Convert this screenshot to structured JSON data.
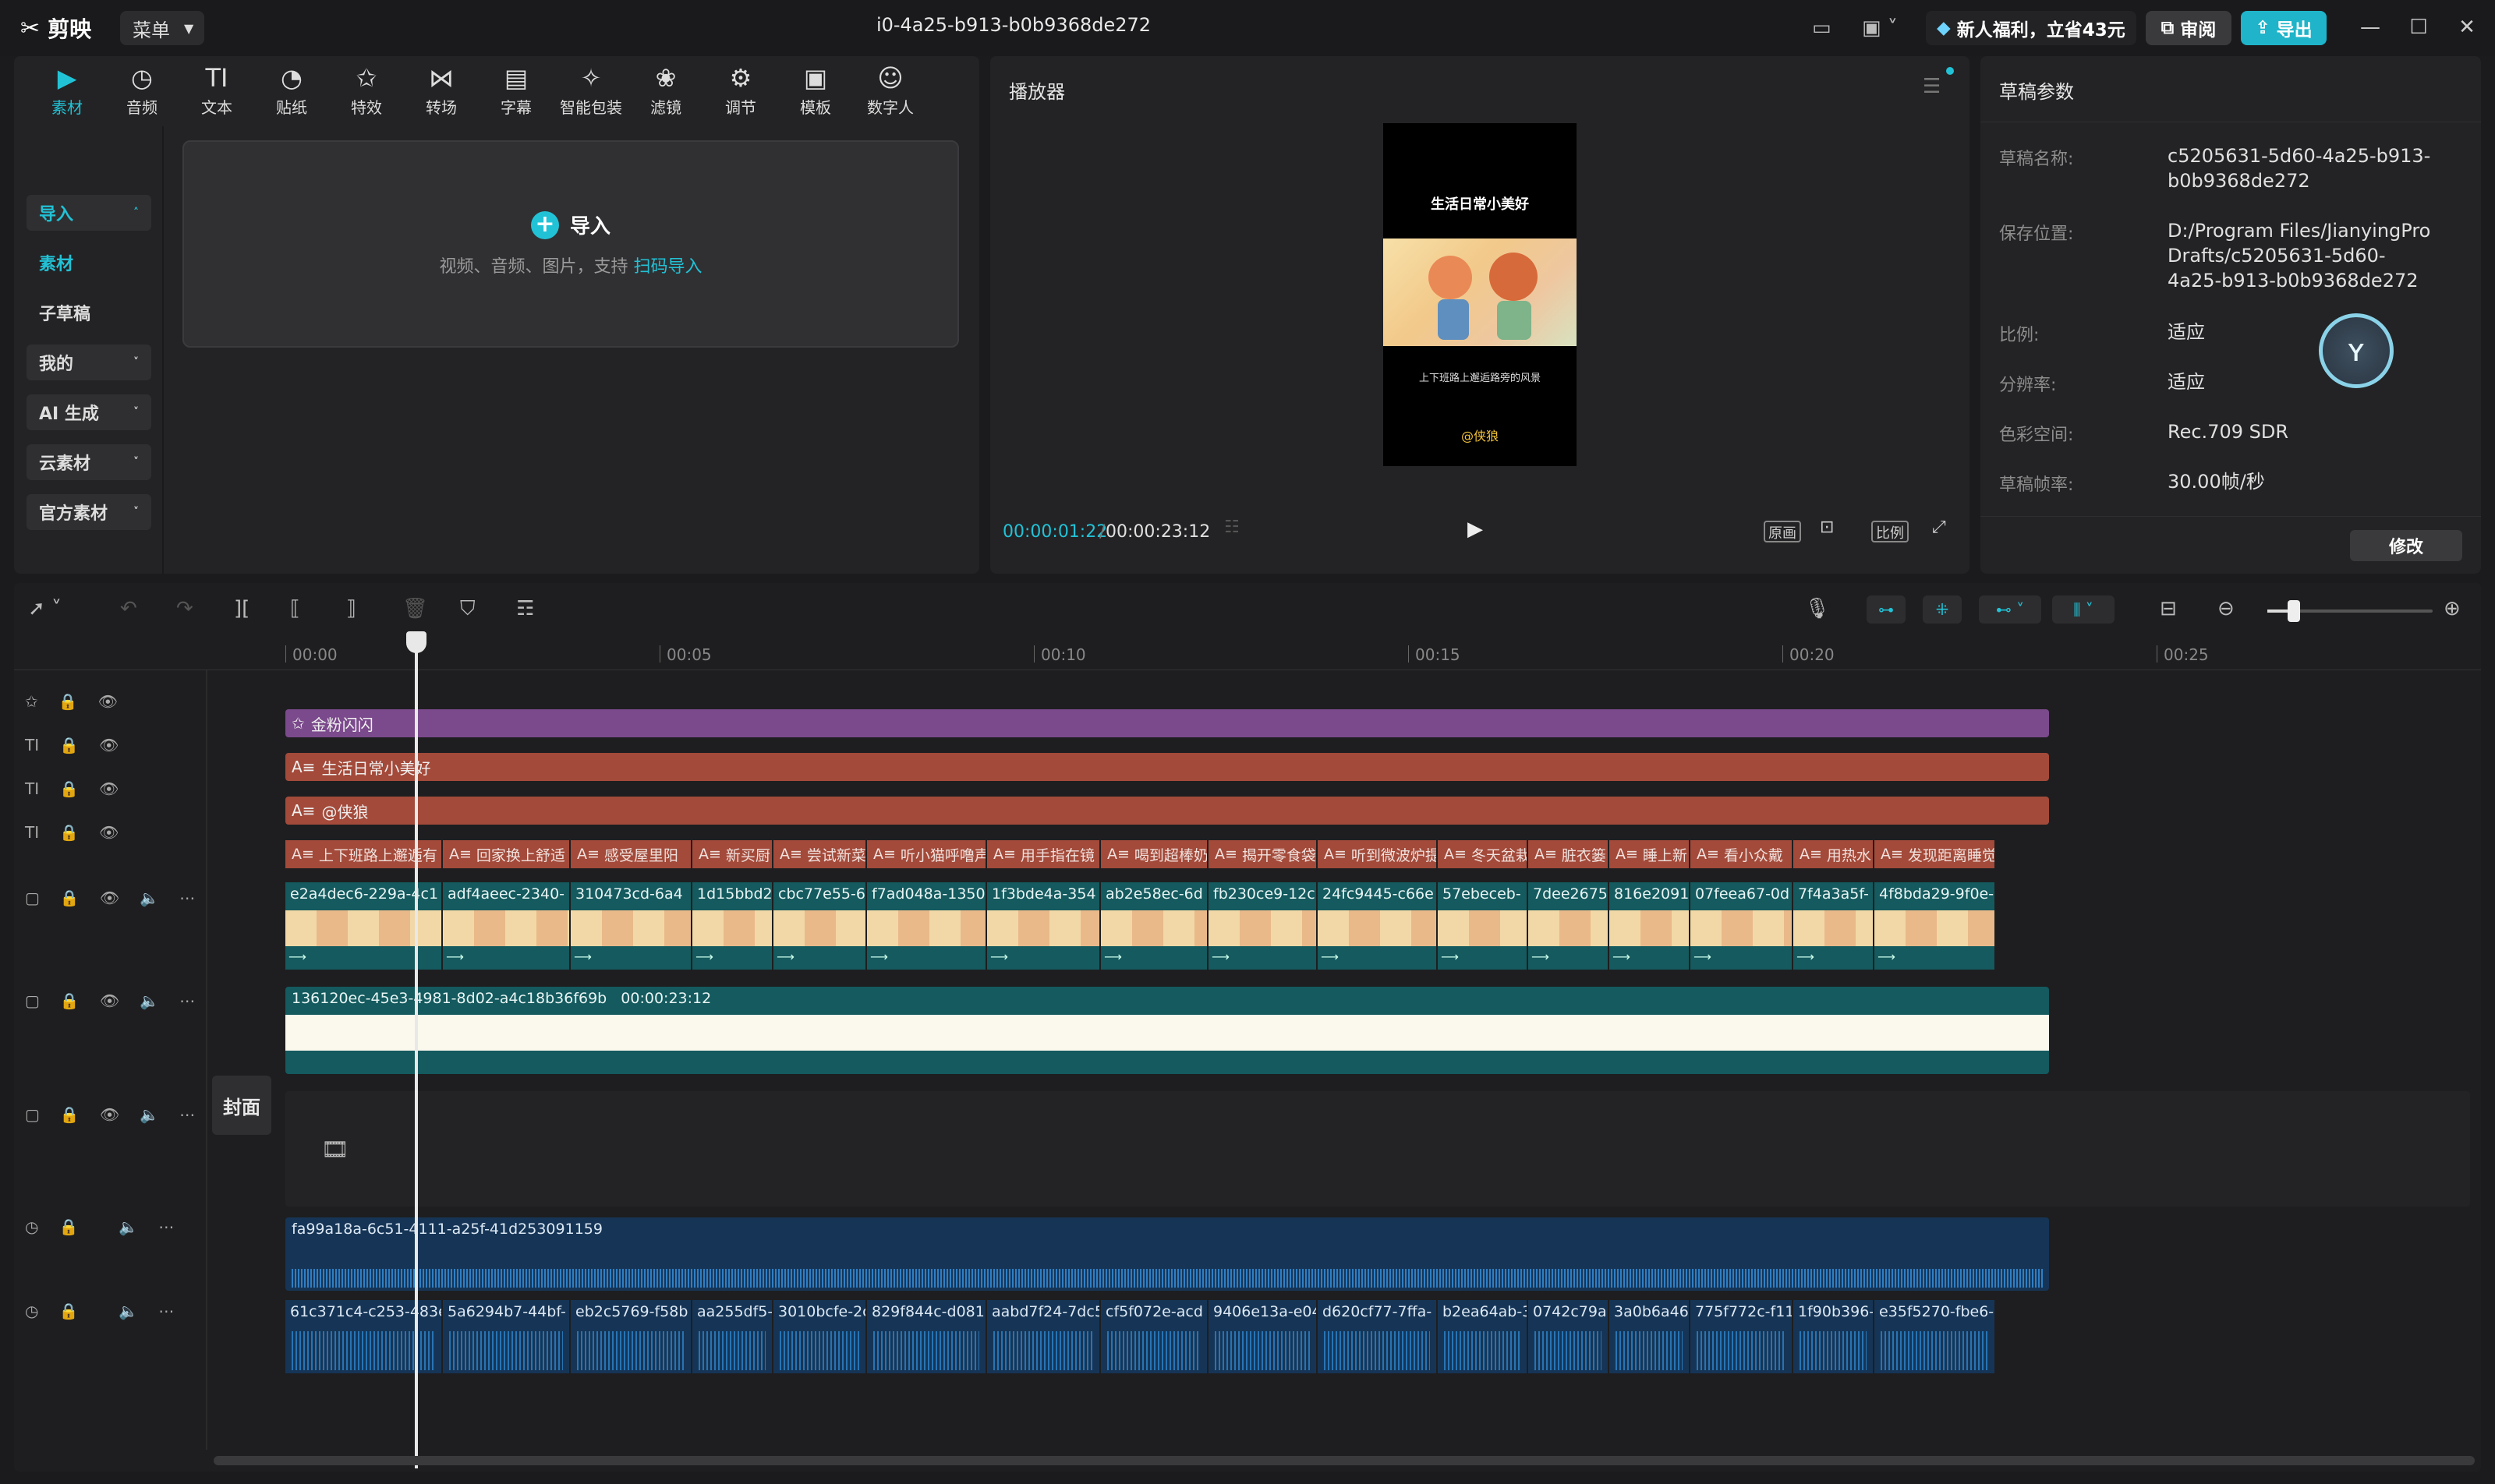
{
  "app": {
    "logo_text": "剪映",
    "menu_label": "菜单",
    "title": "i0-4a25-b913-b0b9368de272"
  },
  "header": {
    "promo": "新人福利，立省43元",
    "review": "审阅",
    "export": "导出"
  },
  "tools": [
    {
      "label": "素材",
      "icon": "▶",
      "active": true
    },
    {
      "label": "音频",
      "icon": "◷"
    },
    {
      "label": "文本",
      "icon": "TI"
    },
    {
      "label": "贴纸",
      "icon": "◔"
    },
    {
      "label": "特效",
      "icon": "✩"
    },
    {
      "label": "转场",
      "icon": "⋈"
    },
    {
      "label": "字幕",
      "icon": "▤"
    },
    {
      "label": "智能包装",
      "icon": "✧"
    },
    {
      "label": "滤镜",
      "icon": "❀"
    },
    {
      "label": "调节",
      "icon": "⚙"
    },
    {
      "label": "模板",
      "icon": "▣"
    },
    {
      "label": "数字人",
      "icon": "☺"
    }
  ],
  "nav": {
    "import": "导入",
    "material": "素材",
    "sub_draft": "子草稿",
    "mine": "我的",
    "ai": "AI 生成",
    "cloud": "云素材",
    "official": "官方素材"
  },
  "import_zone": {
    "title": "导入",
    "sub": "视频、音频、图片，支持",
    "link": "扫码导入"
  },
  "player": {
    "title": "播放器",
    "current": "00:00:01:22",
    "separator": "/",
    "total": "00:00:23:12",
    "original": "原画",
    "ratio": "比例",
    "preview_line1": "生活日常小美好",
    "preview_line2": "上下班路上邂逅路旁的风景",
    "preview_line3": "@侠狼"
  },
  "draft": {
    "title": "草稿参数",
    "rows": [
      {
        "label": "草稿名称:",
        "value": "c5205631-5d60-4a25-b913-b0b9368de272"
      },
      {
        "label": "保存位置:",
        "value": "D:/Program Files/JianyingPro Drafts/c5205631-5d60-4a25-b913-b0b9368de272"
      },
      {
        "label": "比例:",
        "value": "适应"
      },
      {
        "label": "分辨率:",
        "value": "适应"
      },
      {
        "label": "色彩空间:",
        "value": "Rec.709 SDR"
      },
      {
        "label": "草稿帧率:",
        "value": "30.00帧/秒"
      }
    ],
    "modify": "修改"
  },
  "ruler": [
    "00:00",
    "00:05",
    "00:10",
    "00:15",
    "00:20",
    "00:25"
  ],
  "tracks": {
    "effect": "金粉闪闪",
    "text1": "生活日常小美好",
    "text2": "@侠狼",
    "subtitles": [
      "上下班路上邂逅有",
      "回家换上舒适",
      "感受屋里阳",
      "新买厨",
      "尝试新菜",
      "听小猫呼噜声",
      "用手指在镜",
      "喝到超棒奶",
      "揭开零食袋",
      "听到微波炉提",
      "冬天盆栽",
      "脏衣篓",
      "睡上新",
      "看小众戴",
      "用热水",
      "发现距离睡觉"
    ],
    "video": [
      "e2a4dec6-229a-4c1",
      "adf4aeec-2340-",
      "310473cd-6a4",
      "1d15bbd2",
      "cbc77e55-6",
      "f7ad048a-1350",
      "1f3bde4a-354",
      "ab2e58ec-6d",
      "fb230ce9-12c",
      "24fc9445-c66e",
      "57ebeceb-",
      "7dee2675",
      "816e2091",
      "07feea67-0d",
      "7f4a3a5f-",
      "4f8bda29-9f0e-"
    ],
    "bg_clip": "136120ec-45e3-4981-8d02-a4c18b36f69b",
    "bg_duration": "00:00:23:12",
    "cover": "封面",
    "audio1": "fa99a18a-6c51-4111-a25f-41d253091159",
    "audio2": [
      "61c371c4-c253-483e",
      "5a6294b7-44bf-",
      "eb2c5769-f58b",
      "aa255df5-",
      "3010bcfe-2c",
      "829f844c-d081",
      "aabd7f24-7dc5",
      "cf5f072e-acd",
      "9406e13a-e04",
      "d620cf77-7ffa-",
      "b2ea64ab-3",
      "0742c79a",
      "3a0b6a46-",
      "775f772c-f11",
      "1f90b396-",
      "e35f5270-fbe6-"
    ]
  }
}
